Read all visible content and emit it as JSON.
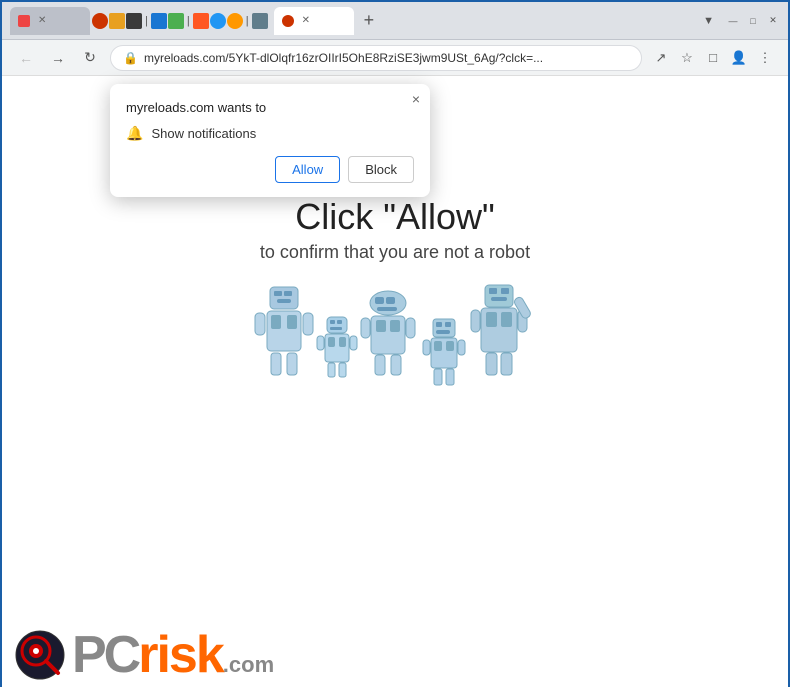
{
  "browser": {
    "titlebar": {
      "tabs": [
        {
          "id": "tab1",
          "label": "",
          "active": false,
          "favicon_color": "#e44"
        },
        {
          "id": "tab2",
          "label": "",
          "active": true,
          "favicon_color": "#cc3300"
        }
      ],
      "new_tab_label": "+",
      "window_controls": {
        "minimize": "—",
        "maximize": "□",
        "close": "✕"
      }
    },
    "addressbar": {
      "url": "myreloads.com/5YkT-dlOlqfr16zrOIIrI5OhE8RziSE3jwm9USt_6Ag/?clck=...",
      "back_title": "Back",
      "forward_title": "Forward",
      "reload_title": "Reload"
    }
  },
  "notification_popup": {
    "title": "myreloads.com wants to",
    "notification_label": "Show notifications",
    "allow_label": "Allow",
    "block_label": "Block",
    "close_label": "×"
  },
  "page": {
    "heading": "Click \"Allow\"",
    "subheading": "to confirm that you are not a robot"
  },
  "footer": {
    "logo_pc": "PC",
    "logo_risk": "risk",
    "logo_dotcom": ".com"
  }
}
